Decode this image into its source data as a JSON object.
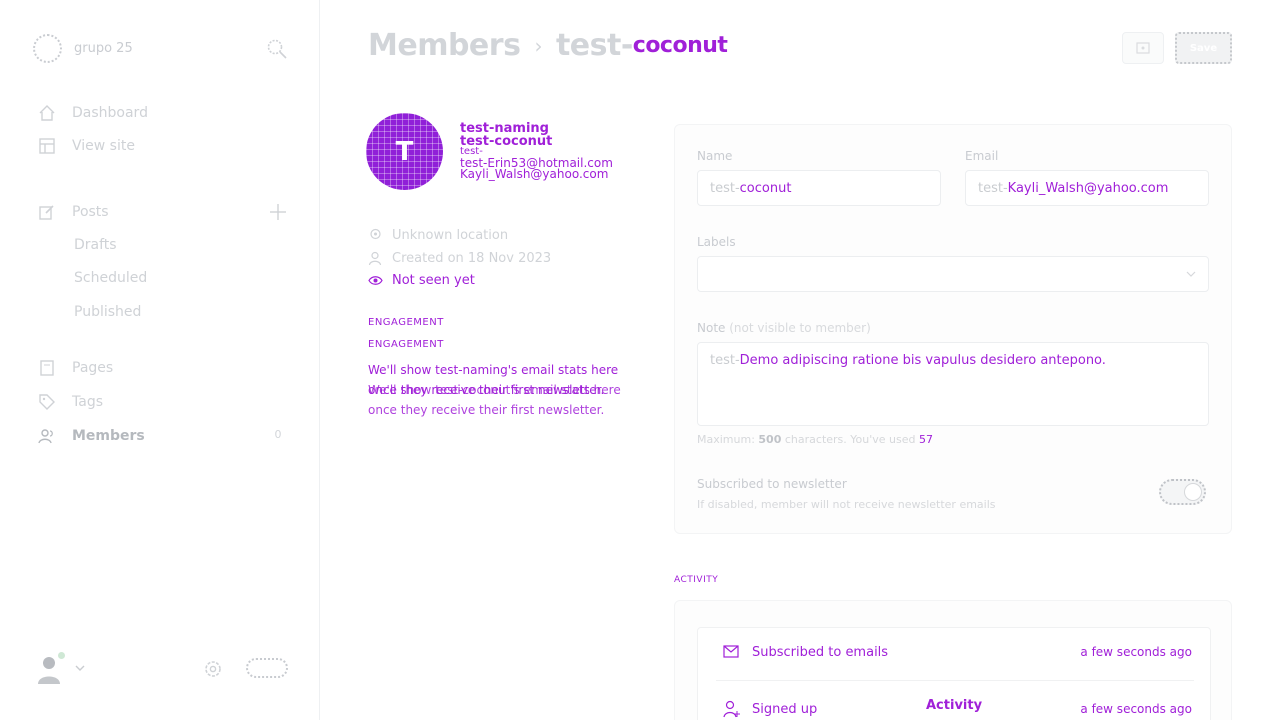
{
  "sidebar": {
    "brand": "grupo 25",
    "nav": {
      "dashboard": "Dashboard",
      "view_site": "View site",
      "posts": "Posts",
      "drafts": "Drafts",
      "scheduled": "Scheduled",
      "published": "Published",
      "pages": "Pages",
      "tags": "Tags",
      "members": "Members"
    },
    "members_count": "0"
  },
  "header": {
    "section": "Members",
    "separator": "›",
    "current_prefix": "test-",
    "current_suffix": "coconut",
    "save_label": "Save"
  },
  "profile": {
    "initial": "T",
    "name": "test-naming",
    "name_alt": "test-coconut",
    "line1": "test-",
    "email1": "test-Erin53@hotmail.com",
    "email2": "Kayli_Walsh@yahoo.com",
    "location": "Unknown location",
    "created": "Created on 18 Nov 2023",
    "last_seen": "Not seen yet",
    "engagement_label": "ENGAGEMENT",
    "engagement_text_1": "We'll show test-naming's email stats here once they receive their first newsletter.",
    "engagement_text_2": "We'll show test-coconut's email stats here once they receive their first newsletter."
  },
  "form": {
    "name_label": "Name",
    "name_prefix": "test-",
    "name_value": "coconut",
    "email_label": "Email",
    "email_prefix": "test-",
    "email_value": "Kayli_Walsh@yahoo.com",
    "labels_label": "Labels",
    "note_label": "Note",
    "note_hint": "(not visible to member)",
    "note_prefix": "test-",
    "note_value": "Demo adipiscing ratione bis vapulus desidero antepono.",
    "char_hint_1": "Maximum:",
    "char_max": "500",
    "char_hint_2": "characters. You've used",
    "char_used": "57",
    "newsletter_title": "Subscribed to newsletter",
    "newsletter_desc": "If disabled, member will not receive newsletter emails"
  },
  "activity": {
    "section_label": "ACTIVITY",
    "title": "Activity",
    "rows": [
      {
        "text": "Subscribed to emails",
        "time": "a few seconds ago"
      },
      {
        "text": "Signed up",
        "time": "a few seconds ago"
      }
    ]
  },
  "colors": {
    "accent": "#a020d8",
    "muted": "#cfd2d6"
  }
}
